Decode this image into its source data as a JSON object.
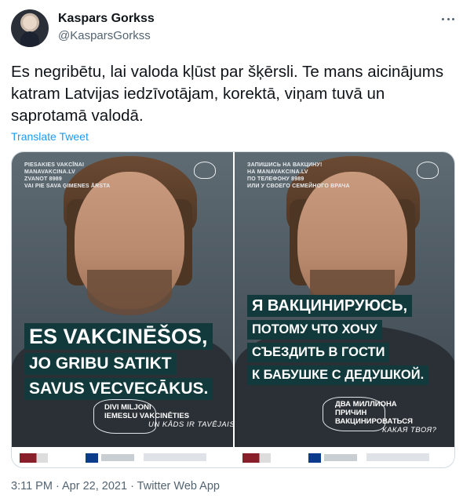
{
  "author": {
    "display_name": "Kaspars Gorkss",
    "handle": "@KasparsGorkss"
  },
  "tweet": {
    "text": "Es negribētu, lai valoda kļūst par šķērsli. Te mans aicinājums katram Latvijas iedzīvotājam, korektā, viņam tuvā un saprotamā valodā.",
    "translate_label": "Translate Tweet",
    "timestamp": "3:11 PM · Apr 22, 2021 · Twitter Web App"
  },
  "media": {
    "left_poster": {
      "info_lines": [
        "PIESAKIES VAKCĪNAI",
        "MANAVAKCINA.LV",
        "ZVANOT 8989",
        "VAI PIE SAVA ĢIMENES ĀRSTA"
      ],
      "headline_lines": [
        "ES VAKCINĒŠOS,",
        "JO GRIBU SATIKT",
        "SAVUS VECVECĀKUS."
      ],
      "caption_lines": [
        "DIVI MILJONI",
        "IEMESLU VAKCINĒTIES"
      ],
      "caption_question": "UN KĀDS IR TAVĒJAIS?"
    },
    "right_poster": {
      "info_lines": [
        "ЗАПИШИСЬ НА ВАКЦИНУ!",
        "НА MANAVAKCINA.LV",
        "ПО ТЕЛЕФОНУ 8989",
        "ИЛИ У СВОЕГО СЕМЕЙНОГО ВРАЧА"
      ],
      "headline_lines": [
        "Я ВАКЦИНИРУЮСЬ,",
        "ПОТОМУ ЧТО ХОЧУ",
        "СЪЕЗДИТЬ В ГОСТИ",
        "К БАБУШКЕ С ДЕДУШКОЙ."
      ],
      "caption_lines": [
        "ДВА МИЛЛИОНА",
        "ПРИЧИН",
        "ВАКЦИНИРОВАТЬСЯ"
      ],
      "caption_question": "КАКАЯ ТВОЯ?"
    }
  },
  "icons": {
    "more": "more-horizontal-icon",
    "crest": "latvia-coat-of-arms-icon"
  },
  "colors": {
    "link": "#1d9bf0",
    "secondary_text": "#536471",
    "headline_bg": "#123a3c"
  }
}
